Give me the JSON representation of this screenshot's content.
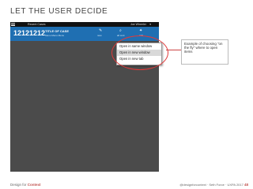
{
  "slide": {
    "title": "LET THE USER DECIDE",
    "bottom_note": "",
    "footer": {
      "left_prefix": "Design for ",
      "left_accent": "Context",
      "right_text": "@designforcontext · Seth Force · UXPA 2017",
      "page_number": "48"
    }
  },
  "app": {
    "topbar": {
      "recent_label": "Recent Cases",
      "user_label": "Joe Wheeler",
      "caret": "▾"
    },
    "header": {
      "case_number": "12121212",
      "case_title": "TITLE OF CASE",
      "case_meta": "Menu  Menu  Menu",
      "actions": [
        {
          "icon": "✎",
          "label": "new"
        },
        {
          "icon": "⌕",
          "label": "all cont"
        },
        {
          "icon": "✦",
          "label": "wiki"
        }
      ]
    },
    "dropdown": {
      "items": [
        "Open in same window",
        "Open in new window",
        "Open in new tab"
      ],
      "highlighted_index": 1
    }
  },
  "callout": {
    "text": "Example of choosing \"on the fly\" where to open items"
  },
  "colors": {
    "header_blue": "#1f6fb2",
    "workspace_gray": "#4b4b4b",
    "highlight_red": "#e03a3a",
    "accent_red": "#c0504d"
  }
}
